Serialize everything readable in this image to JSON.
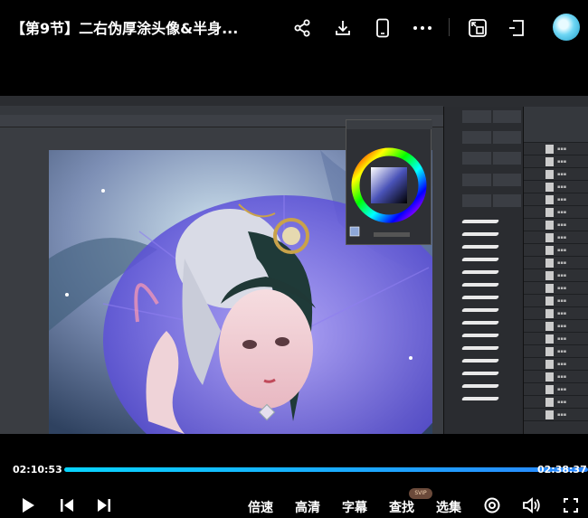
{
  "header": {
    "title": "【第9节】二右伪厚涂头像&半身...",
    "icons": [
      "share-icon",
      "download-icon",
      "phone-icon",
      "more-icon",
      "pip-icon",
      "fullscreen-exit-icon",
      "avatar"
    ]
  },
  "player": {
    "current_time": "02:10:53",
    "total_time": "02:38:37",
    "progress": 0.99,
    "controls": {
      "speed": "倍速",
      "quality": "高清",
      "subtitles": "字幕",
      "search": "查找",
      "search_badge": "SVIP",
      "episodes": "选集"
    }
  },
  "colors": {
    "accent": "#08d4ff",
    "background": "#000000"
  }
}
